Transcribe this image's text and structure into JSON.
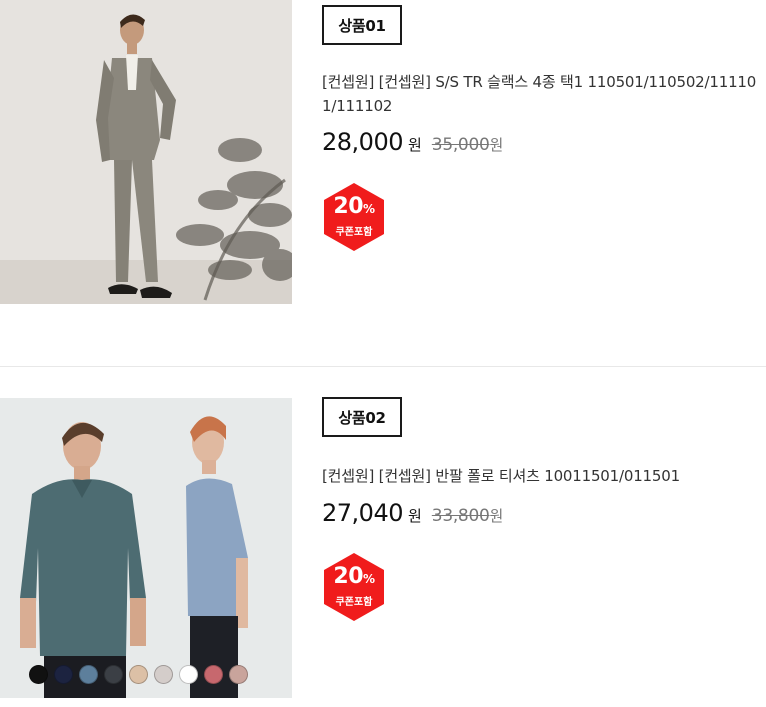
{
  "products": [
    {
      "tag": "상품01",
      "name": "[컨셉원] [컨셉원] S/S TR 슬랙스 4종 택1 110501/110502/111101/111102",
      "price": "28,000",
      "currency": "원",
      "original_price": "35,000",
      "original_currency": "원",
      "discount_value": "20",
      "discount_unit": "%",
      "discount_label": "쿠폰포함",
      "image": "man-in-grey-suit-photo"
    },
    {
      "tag": "상품02",
      "name": "[컨셉원] [컨셉원] 반팔 폴로 티셔츠 10011501/011501",
      "price": "27,040",
      "currency": "원",
      "original_price": "33,800",
      "original_currency": "원",
      "discount_value": "20",
      "discount_unit": "%",
      "discount_label": "쿠폰포함",
      "image": "two-men-in-polo-shirts-photo",
      "color_swatches": [
        "#111111",
        "#1c2340",
        "#5d7f9c",
        "#3b3f45",
        "#dcc0a6",
        "#d4cdca",
        "#ffffff",
        "#c7686e",
        "#c9a49c"
      ]
    }
  ],
  "colors": {
    "badge_red": "#f01c1c",
    "tag_border": "#1a1a1a",
    "divider": "#e8e8e8"
  }
}
